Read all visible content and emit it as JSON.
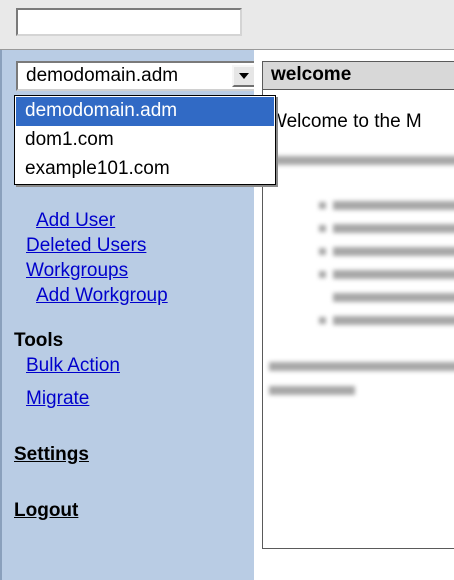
{
  "header": {
    "search_value": ""
  },
  "sidebar": {
    "domain_select": {
      "value": "demodomain.adm",
      "options": [
        "demodomain.adm",
        "dom1.com",
        "example101.com"
      ]
    },
    "links": {
      "add_user": "Add User",
      "deleted_users": "Deleted Users",
      "workgroups": "Workgroups",
      "add_workgroup": "Add Workgroup"
    },
    "tools": {
      "heading": "Tools",
      "bulk_action": "Bulk Action",
      "migrate": "Migrate"
    },
    "settings": "Settings",
    "logout": "Logout"
  },
  "main": {
    "panel_title": "welcome",
    "welcome_text": "Welcome to the M"
  },
  "colors": {
    "sidebar_bg": "#b9cce4",
    "link": "#0000cc",
    "selection": "#316ac5"
  },
  "icons": {
    "dropdown_arrow": "chevron-down-icon"
  }
}
